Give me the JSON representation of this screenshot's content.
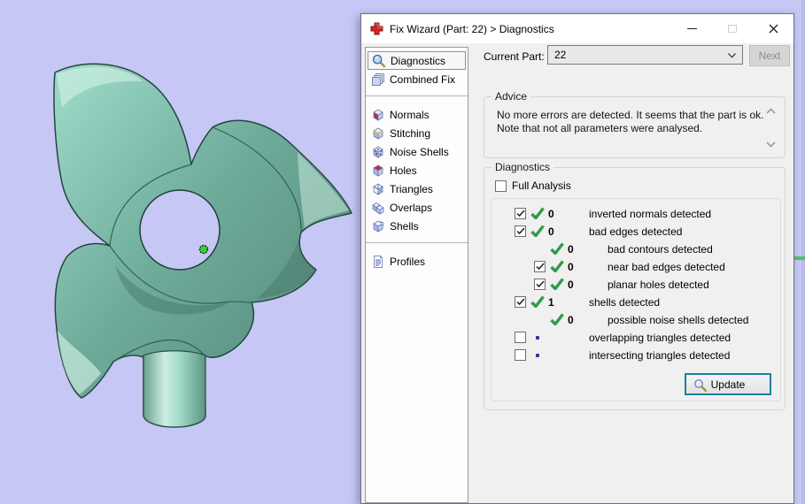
{
  "window": {
    "title": "Fix Wizard (Part: 22) > Diagnostics",
    "controls": [
      "minimize",
      "maximize",
      "close"
    ]
  },
  "toolbar": {
    "current_part_label": "Current Part:",
    "current_part_value": "22",
    "next_label": "Next"
  },
  "sidebar": {
    "groups": [
      {
        "items": [
          {
            "label": "Diagnostics",
            "icon": "magnifier-icon",
            "selected": true
          },
          {
            "label": "Combined Fix",
            "icon": "combined-fix-icon",
            "selected": false
          }
        ]
      },
      {
        "items": [
          {
            "label": "Normals",
            "icon": "cube-normals-icon",
            "selected": false
          },
          {
            "label": "Stitching",
            "icon": "cube-stitching-icon",
            "selected": false
          },
          {
            "label": "Noise Shells",
            "icon": "cube-noise-shells-icon",
            "selected": false
          },
          {
            "label": "Holes",
            "icon": "cube-holes-icon",
            "selected": false
          },
          {
            "label": "Triangles",
            "icon": "cube-triangles-icon",
            "selected": false
          },
          {
            "label": "Overlaps",
            "icon": "cube-overlaps-icon",
            "selected": false
          },
          {
            "label": "Shells",
            "icon": "cube-shells-icon",
            "selected": false
          }
        ]
      },
      {
        "items": [
          {
            "label": "Profiles",
            "icon": "profiles-icon",
            "selected": false
          }
        ]
      }
    ]
  },
  "advice": {
    "title": "Advice",
    "lines": [
      "No more errors are detected. It seems that the part is ok.",
      "Note that not all parameters were analysed."
    ]
  },
  "diagnostics": {
    "title": "Diagnostics",
    "full_analysis_label": "Full Analysis",
    "full_analysis_checked": false,
    "rows": [
      {
        "label": "inverted normals detected",
        "count": "0",
        "checked": true,
        "status": "ok",
        "indent": 0
      },
      {
        "label": "bad edges detected",
        "count": "0",
        "checked": true,
        "status": "ok",
        "indent": 0
      },
      {
        "label": "bad contours detected",
        "count": "0",
        "checked": null,
        "status": "ok",
        "indent": 1
      },
      {
        "label": "near bad edges detected",
        "count": "0",
        "checked": true,
        "status": "ok",
        "indent": 1
      },
      {
        "label": "planar holes detected",
        "count": "0",
        "checked": true,
        "status": "ok",
        "indent": 1
      },
      {
        "label": "shells detected",
        "count": "1",
        "checked": true,
        "status": "ok",
        "indent": 0
      },
      {
        "label": "possible noise shells detected",
        "count": "0",
        "checked": null,
        "status": "ok",
        "indent": 1
      },
      {
        "label": "overlapping triangles detected",
        "count": "",
        "checked": false,
        "status": "pending",
        "indent": 0
      },
      {
        "label": "intersecting triangles detected",
        "count": "",
        "checked": false,
        "status": "pending",
        "indent": 0
      }
    ],
    "update_label": "Update"
  },
  "colors": {
    "viewport_bg": "#c6c7f5",
    "model_teal_light": "#9fdcca",
    "model_teal_dark": "#4e8374",
    "check_green": "#2e9b4a",
    "pending_dot_blue": "#2b3a9c",
    "update_border_teal": "#1e7f9f",
    "origin_marker_green": "#35d435",
    "axis_line_green": "#52bd6d"
  }
}
